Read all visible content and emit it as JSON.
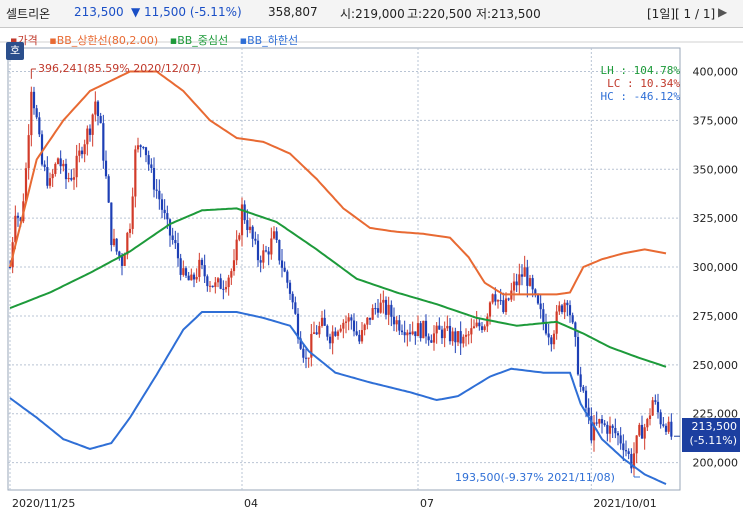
{
  "header": {
    "name": "셀트리온",
    "price": "213,500",
    "change": "▼ 11,500 (-5.11%)",
    "volume": "358,807",
    "open": "시:219,000",
    "high": "고:220,500",
    "low": "저:213,500",
    "period": "[1일][ 1 / 1]",
    "arrow": "▶"
  },
  "chart_data": {
    "type": "candlestick",
    "legend": {
      "price": "가격",
      "upper": "BB_상한선(80,2.00)",
      "mid": "BB_중심선",
      "lower": "BB_하한선"
    },
    "ho_label": "호",
    "y_ticks": [
      "400,000",
      "375,000",
      "350,000",
      "325,000",
      "300,000",
      "275,000",
      "250,000",
      "225,000",
      "200,000"
    ],
    "y_tick_values": [
      400000,
      375000,
      350000,
      325000,
      300000,
      275000,
      250000,
      225000,
      200000
    ],
    "ylim": [
      186000,
      412000
    ],
    "x_tick_labels": [
      "2020/11/25",
      "04",
      "07",
      "2021/10/01"
    ],
    "x_tick_index": [
      0,
      87,
      153,
      218
    ],
    "n_days": 250,
    "stats": {
      "lh": "LH : 104.78%",
      "lc": "LC :  10.34%",
      "hc": "HC : -46.12%"
    },
    "current_price": {
      "value": 213500,
      "label": "213,500",
      "change": "(-5.11%)"
    },
    "max_annotation": {
      "text": "396,241(85.59% 2020/12/07)",
      "value": 396241,
      "index": 8
    },
    "min_annotation": {
      "text": "193,500(-9.37% 2021/11/08)",
      "value": 193500,
      "index": 234
    },
    "upper_band": [
      [
        0,
        300000
      ],
      [
        10,
        355000
      ],
      [
        20,
        375000
      ],
      [
        30,
        390000
      ],
      [
        45,
        400000
      ],
      [
        55,
        400000
      ],
      [
        65,
        390000
      ],
      [
        75,
        375000
      ],
      [
        85,
        366000
      ],
      [
        95,
        364000
      ],
      [
        105,
        358000
      ],
      [
        115,
        345000
      ],
      [
        125,
        330000
      ],
      [
        135,
        320000
      ],
      [
        145,
        318000
      ],
      [
        155,
        317000
      ],
      [
        165,
        315000
      ],
      [
        172,
        305000
      ],
      [
        178,
        292000
      ],
      [
        185,
        286000
      ],
      [
        195,
        286000
      ],
      [
        205,
        286000
      ],
      [
        210,
        287000
      ],
      [
        215,
        300000
      ],
      [
        222,
        304000
      ],
      [
        230,
        307000
      ],
      [
        238,
        309000
      ],
      [
        246,
        307000
      ]
    ],
    "mid_band": [
      [
        0,
        279000
      ],
      [
        15,
        287000
      ],
      [
        30,
        297000
      ],
      [
        45,
        308000
      ],
      [
        60,
        322000
      ],
      [
        72,
        329000
      ],
      [
        85,
        330000
      ],
      [
        100,
        323000
      ],
      [
        115,
        309000
      ],
      [
        130,
        294000
      ],
      [
        145,
        287000
      ],
      [
        160,
        281000
      ],
      [
        175,
        274000
      ],
      [
        190,
        270000
      ],
      [
        205,
        272000
      ],
      [
        215,
        266000
      ],
      [
        225,
        259000
      ],
      [
        235,
        254000
      ],
      [
        246,
        249000
      ]
    ],
    "lower_band": [
      [
        0,
        233000
      ],
      [
        10,
        223000
      ],
      [
        20,
        212000
      ],
      [
        30,
        207000
      ],
      [
        38,
        210000
      ],
      [
        45,
        223000
      ],
      [
        55,
        245000
      ],
      [
        65,
        268000
      ],
      [
        72,
        277000
      ],
      [
        85,
        277000
      ],
      [
        95,
        274000
      ],
      [
        105,
        270000
      ],
      [
        112,
        257000
      ],
      [
        122,
        246000
      ],
      [
        135,
        241000
      ],
      [
        150,
        236000
      ],
      [
        160,
        232000
      ],
      [
        168,
        234000
      ],
      [
        180,
        244000
      ],
      [
        188,
        248000
      ],
      [
        200,
        246000
      ],
      [
        210,
        246000
      ],
      [
        214,
        230000
      ],
      [
        222,
        212000
      ],
      [
        230,
        202000
      ],
      [
        238,
        194000
      ],
      [
        246,
        189000
      ]
    ],
    "price_anchors": [
      [
        0,
        300000
      ],
      [
        2,
        330000
      ],
      [
        4,
        322000
      ],
      [
        6,
        350000
      ],
      [
        8,
        393000
      ],
      [
        10,
        375000
      ],
      [
        12,
        352000
      ],
      [
        15,
        342000
      ],
      [
        18,
        356000
      ],
      [
        21,
        345000
      ],
      [
        24,
        348000
      ],
      [
        27,
        362000
      ],
      [
        30,
        372000
      ],
      [
        32,
        385000
      ],
      [
        34,
        370000
      ],
      [
        36,
        345000
      ],
      [
        38,
        315000
      ],
      [
        40,
        308000
      ],
      [
        42,
        303000
      ],
      [
        45,
        323000
      ],
      [
        47,
        358000
      ],
      [
        50,
        365000
      ],
      [
        53,
        347000
      ],
      [
        56,
        335000
      ],
      [
        59,
        320000
      ],
      [
        62,
        310000
      ],
      [
        65,
        295000
      ],
      [
        68,
        292000
      ],
      [
        71,
        300000
      ],
      [
        74,
        294000
      ],
      [
        77,
        290000
      ],
      [
        80,
        292000
      ],
      [
        84,
        300000
      ],
      [
        87,
        330000
      ],
      [
        90,
        318000
      ],
      [
        93,
        305000
      ],
      [
        96,
        307000
      ],
      [
        99,
        315000
      ],
      [
        102,
        301000
      ],
      [
        105,
        288000
      ],
      [
        108,
        268000
      ],
      [
        111,
        252000
      ],
      [
        114,
        266000
      ],
      [
        117,
        270000
      ],
      [
        120,
        265000
      ],
      [
        124,
        272000
      ],
      [
        128,
        273000
      ],
      [
        131,
        262000
      ],
      [
        135,
        275000
      ],
      [
        138,
        281000
      ],
      [
        142,
        277000
      ],
      [
        145,
        272000
      ],
      [
        150,
        268000
      ],
      [
        155,
        268000
      ],
      [
        158,
        265000
      ],
      [
        162,
        267000
      ],
      [
        165,
        265000
      ],
      [
        170,
        262000
      ],
      [
        174,
        268000
      ],
      [
        178,
        272000
      ],
      [
        181,
        289000
      ],
      [
        185,
        277000
      ],
      [
        189,
        290000
      ],
      [
        193,
        298000
      ],
      [
        197,
        282000
      ],
      [
        200,
        272000
      ],
      [
        203,
        265000
      ],
      [
        206,
        278000
      ],
      [
        209,
        285000
      ],
      [
        212,
        260000
      ],
      [
        214,
        238000
      ],
      [
        216,
        228000
      ],
      [
        218,
        215000
      ],
      [
        221,
        220000
      ],
      [
        224,
        218000
      ],
      [
        227,
        215000
      ],
      [
        230,
        210000
      ],
      [
        233,
        200000
      ],
      [
        236,
        215000
      ],
      [
        239,
        220000
      ],
      [
        241,
        232000
      ],
      [
        244,
        222000
      ],
      [
        246,
        220000
      ],
      [
        248,
        213500
      ]
    ]
  }
}
